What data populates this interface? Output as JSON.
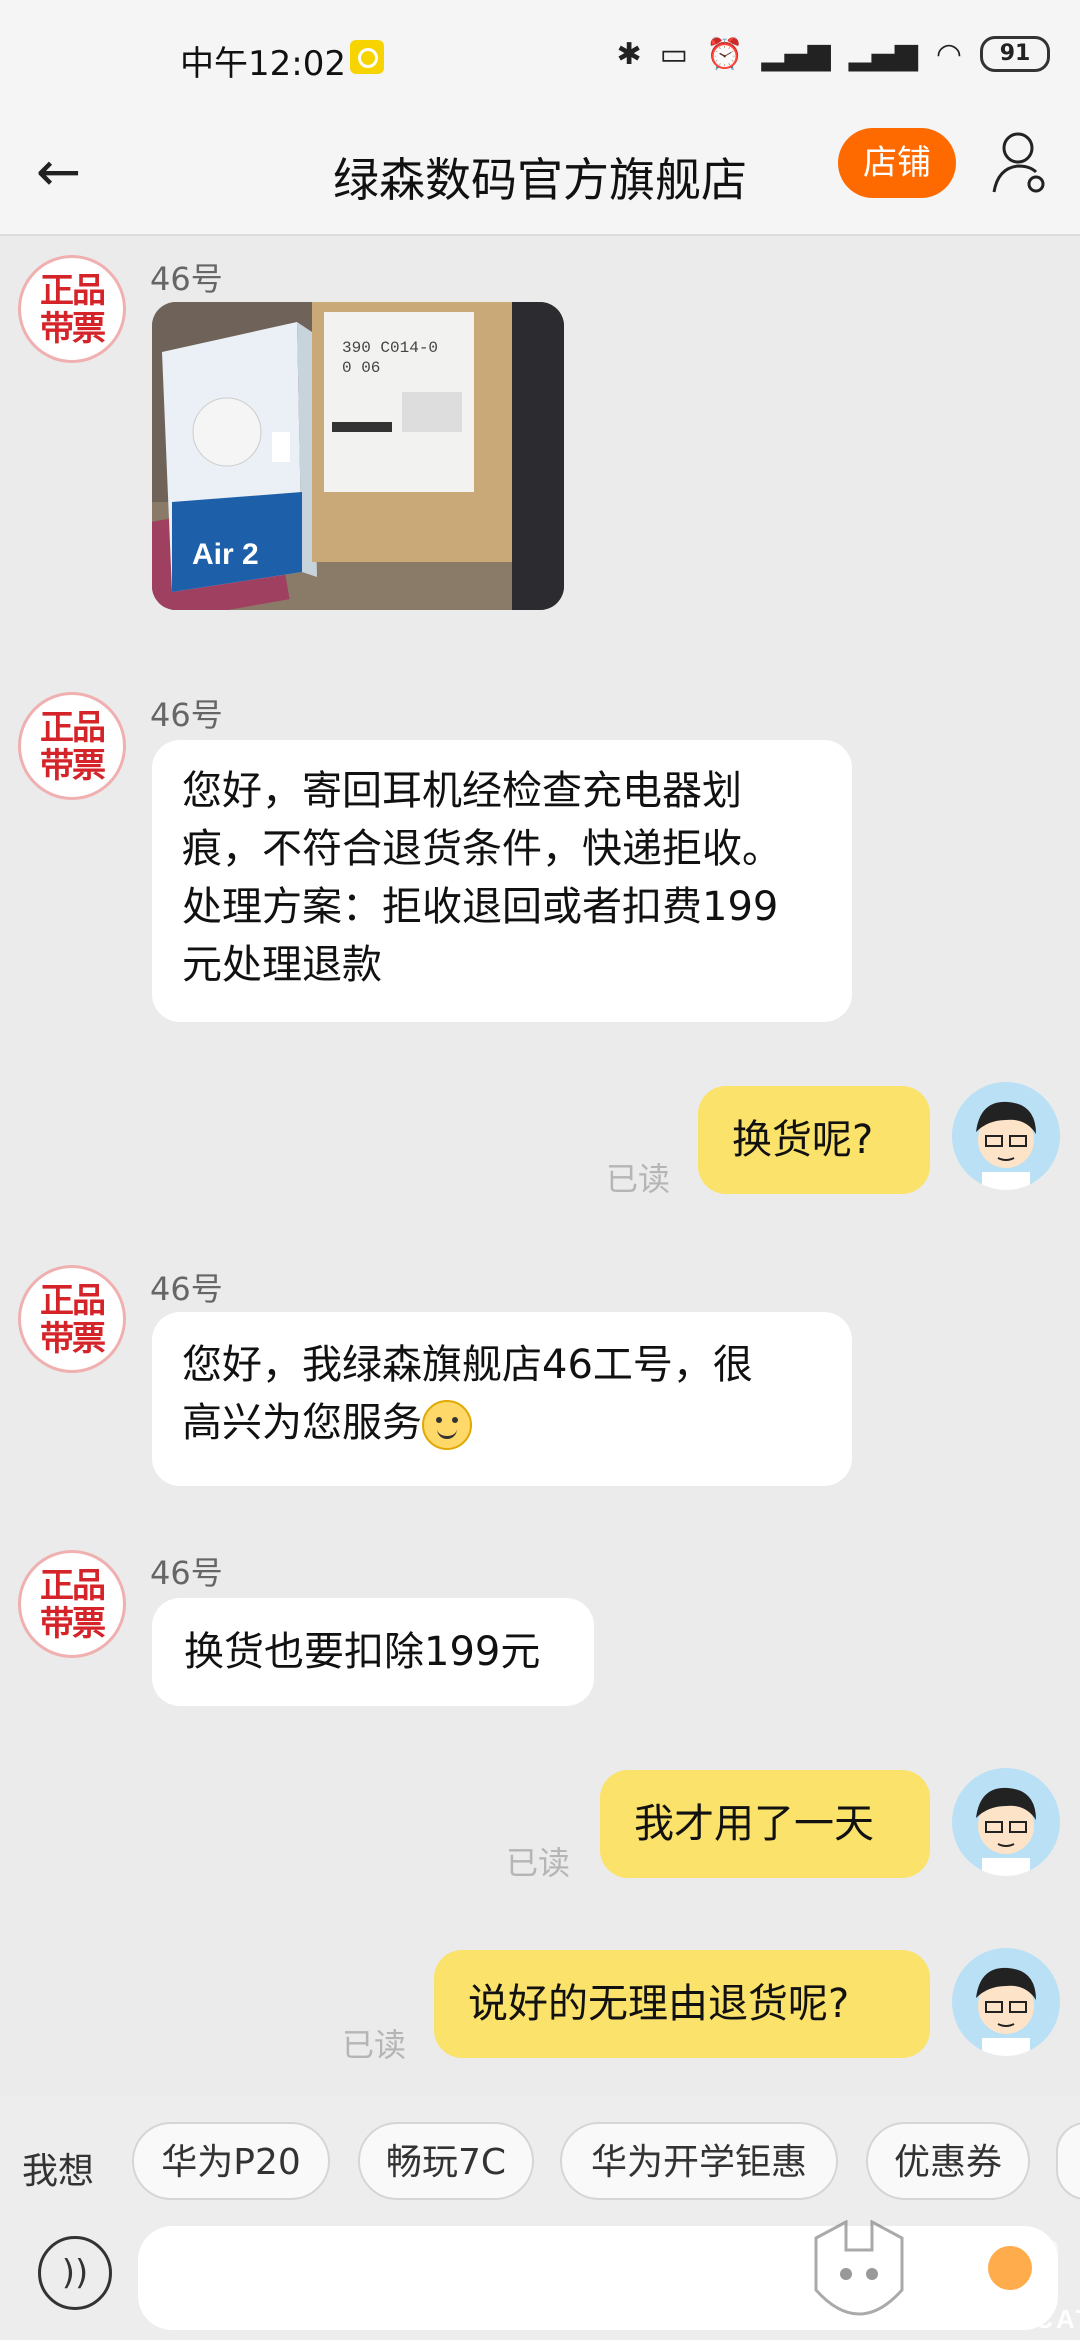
{
  "status_bar": {
    "time": "中午12:02",
    "battery": "91"
  },
  "header": {
    "title": "绿森数码官方旗舰店",
    "shop_button": "店铺"
  },
  "messages": [
    {
      "side": "left",
      "sender": "46号",
      "avatar_text": "正品\n带票",
      "kind": "image",
      "image_text": "Air 2"
    },
    {
      "side": "left",
      "sender": "46号",
      "avatar_text": "正品\n带票",
      "kind": "text",
      "lines": [
        "您好，寄回耳机经检查充电器划",
        "痕，不符合退货条件，快递拒收。",
        "处理方案：拒收退回或者扣费199",
        "元处理退款"
      ]
    },
    {
      "side": "right",
      "text": "换货呢?",
      "read": "已读"
    },
    {
      "side": "left",
      "sender": "46号",
      "avatar_text": "正品\n带票",
      "kind": "text",
      "lines": [
        "您好，我绿森旗舰店46工号，很",
        "高兴为您服务"
      ]
    },
    {
      "side": "left",
      "sender": "46号",
      "avatar_text": "正品\n带票",
      "kind": "text",
      "lines": [
        "换货也要扣除199元"
      ]
    },
    {
      "side": "right",
      "text": "我才用了一天",
      "read": "已读"
    },
    {
      "side": "right",
      "text": "说好的无理由退货呢?",
      "read": "已读"
    }
  ],
  "suggestions": {
    "label": "我想",
    "chips": [
      "华为P20",
      "畅玩7C",
      "华为开学钜惠",
      "优惠券"
    ]
  },
  "input": {
    "placeholder": ""
  },
  "watermark": {
    "text": "黑猫",
    "subtext": "BLACK CAT"
  },
  "colors": {
    "accent": "#ff6a00",
    "own_bubble": "#fbe26a",
    "seal_red": "#d4242a"
  }
}
